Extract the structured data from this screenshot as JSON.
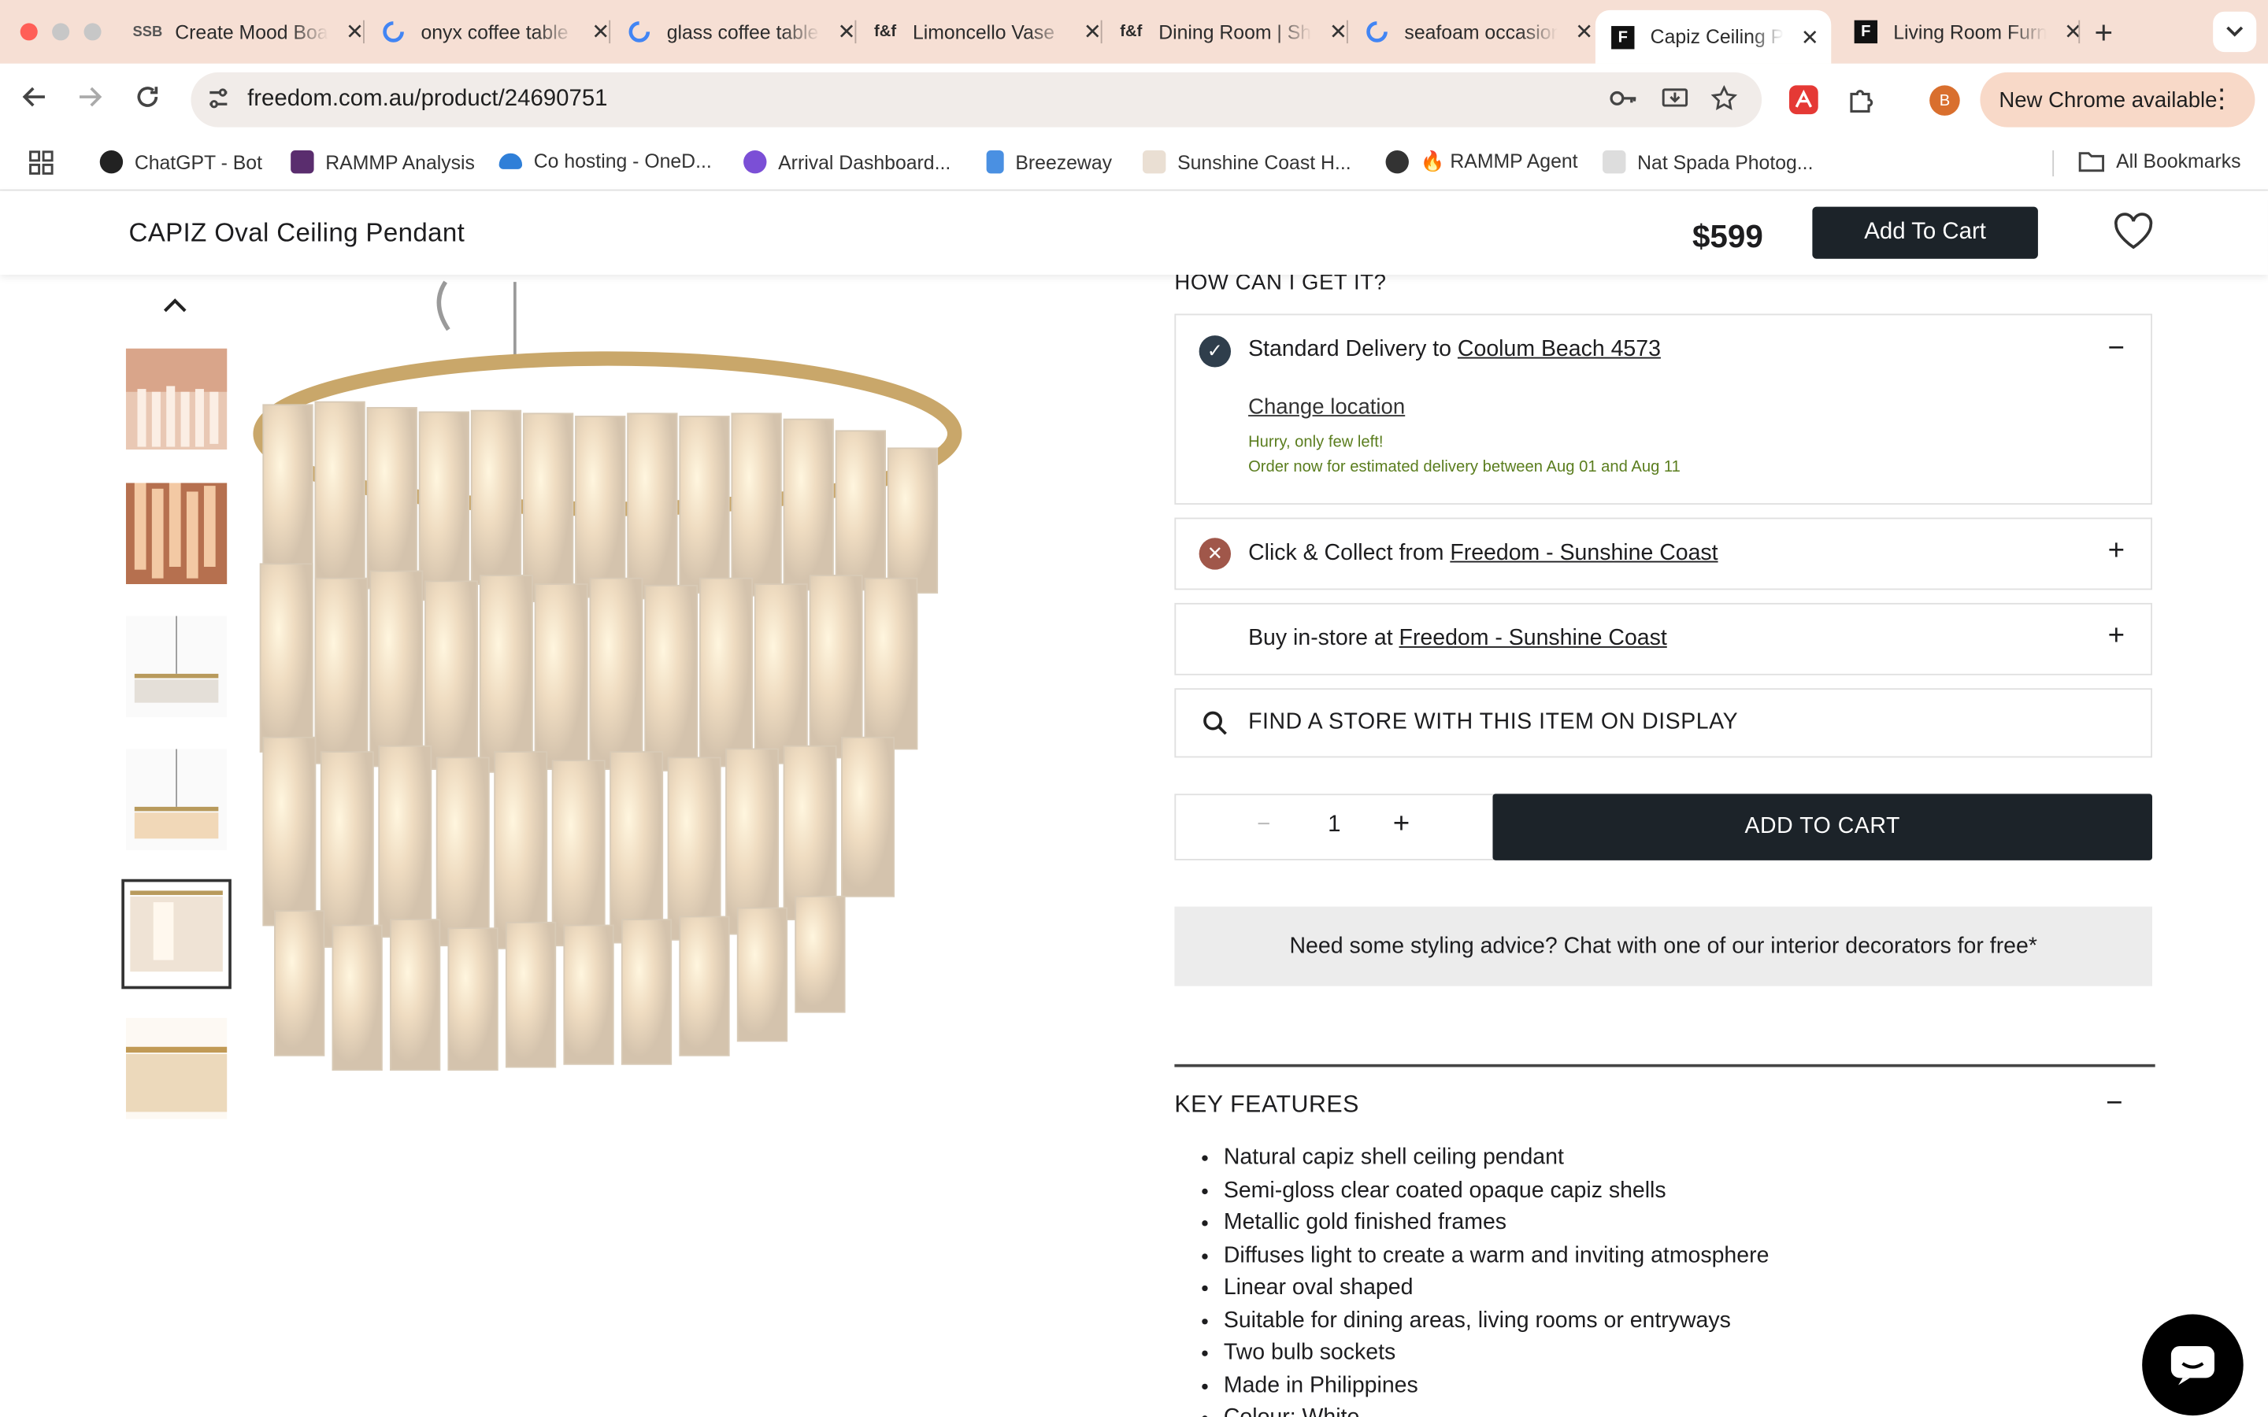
{
  "browser": {
    "tabs": [
      {
        "title": "Create Mood Board",
        "icon": "ssb-icon"
      },
      {
        "title": "onyx coffee table",
        "icon": "google-icon"
      },
      {
        "title": "glass coffee table",
        "icon": "google-icon"
      },
      {
        "title": "Limoncello Vase",
        "icon": "ff-icon"
      },
      {
        "title": "Dining Room | Shop",
        "icon": "ff-icon"
      },
      {
        "title": "seafoam occasional",
        "icon": "google-icon"
      },
      {
        "title": "Capiz Ceiling Pendant",
        "icon": "freedom-icon",
        "active": true
      },
      {
        "title": "Living Room Furniture",
        "icon": "freedom-icon"
      }
    ],
    "url": "freedom.com.au/product/24690751",
    "avatar_letter": "B",
    "new_chrome_label": "New Chrome available",
    "bookmarks": [
      {
        "label": "ChatGPT - Bot"
      },
      {
        "label": "RAMMP Analysis"
      },
      {
        "label": "Co hosting - OneD..."
      },
      {
        "label": "Arrival Dashboard..."
      },
      {
        "label": "Breezeway"
      },
      {
        "label": "Sunshine Coast H..."
      },
      {
        "label": "🔥 RAMMP Agent"
      },
      {
        "label": "Nat Spada Photog..."
      }
    ],
    "all_bookmarks_label": "All Bookmarks"
  },
  "product": {
    "name": "CAPIZ Oval Ceiling Pendant",
    "price": "$599",
    "add_to_cart_label": "Add To Cart"
  },
  "delivery": {
    "heading": "HOW CAN I GET IT?",
    "standard": {
      "prefix": "Standard Delivery to",
      "location": "Coolum Beach 4573",
      "change_location": "Change location",
      "stock_note": "Hurry, only few left!",
      "eta_note": "Order now for estimated delivery between Aug 01 and Aug 11",
      "toggle": "−"
    },
    "click_collect": {
      "prefix": "Click & Collect from",
      "store": "Freedom - Sunshine Coast",
      "toggle": "+"
    },
    "instore": {
      "prefix": "Buy in-store at",
      "store": "Freedom - Sunshine Coast",
      "toggle": "+"
    },
    "find_store": "FIND A STORE WITH THIS ITEM ON DISPLAY"
  },
  "purchase": {
    "qty": "1",
    "minus": "−",
    "plus": "+",
    "add_to_cart": "ADD TO CART"
  },
  "advice": "Need some styling advice? Chat with one of our interior decorators for free*",
  "key_features": {
    "title": "KEY FEATURES",
    "toggle": "−",
    "items": [
      "Natural capiz shell ceiling pendant",
      "Semi-gloss clear coated opaque capiz shells",
      "Metallic gold finished frames",
      "Diffuses light to create a warm and inviting atmosphere",
      "Linear oval shaped",
      "Suitable for dining areas, living rooms or entryways",
      "Two bulb sockets",
      "Made in Philippines",
      "Colour: White"
    ]
  },
  "colors": {
    "tabstrip": "#f6dfd4",
    "dark_button": "#1c2329",
    "green_note": "#5a7d1e",
    "delivery_check": "#2f3e4c",
    "collect_x": "#a0574a"
  }
}
